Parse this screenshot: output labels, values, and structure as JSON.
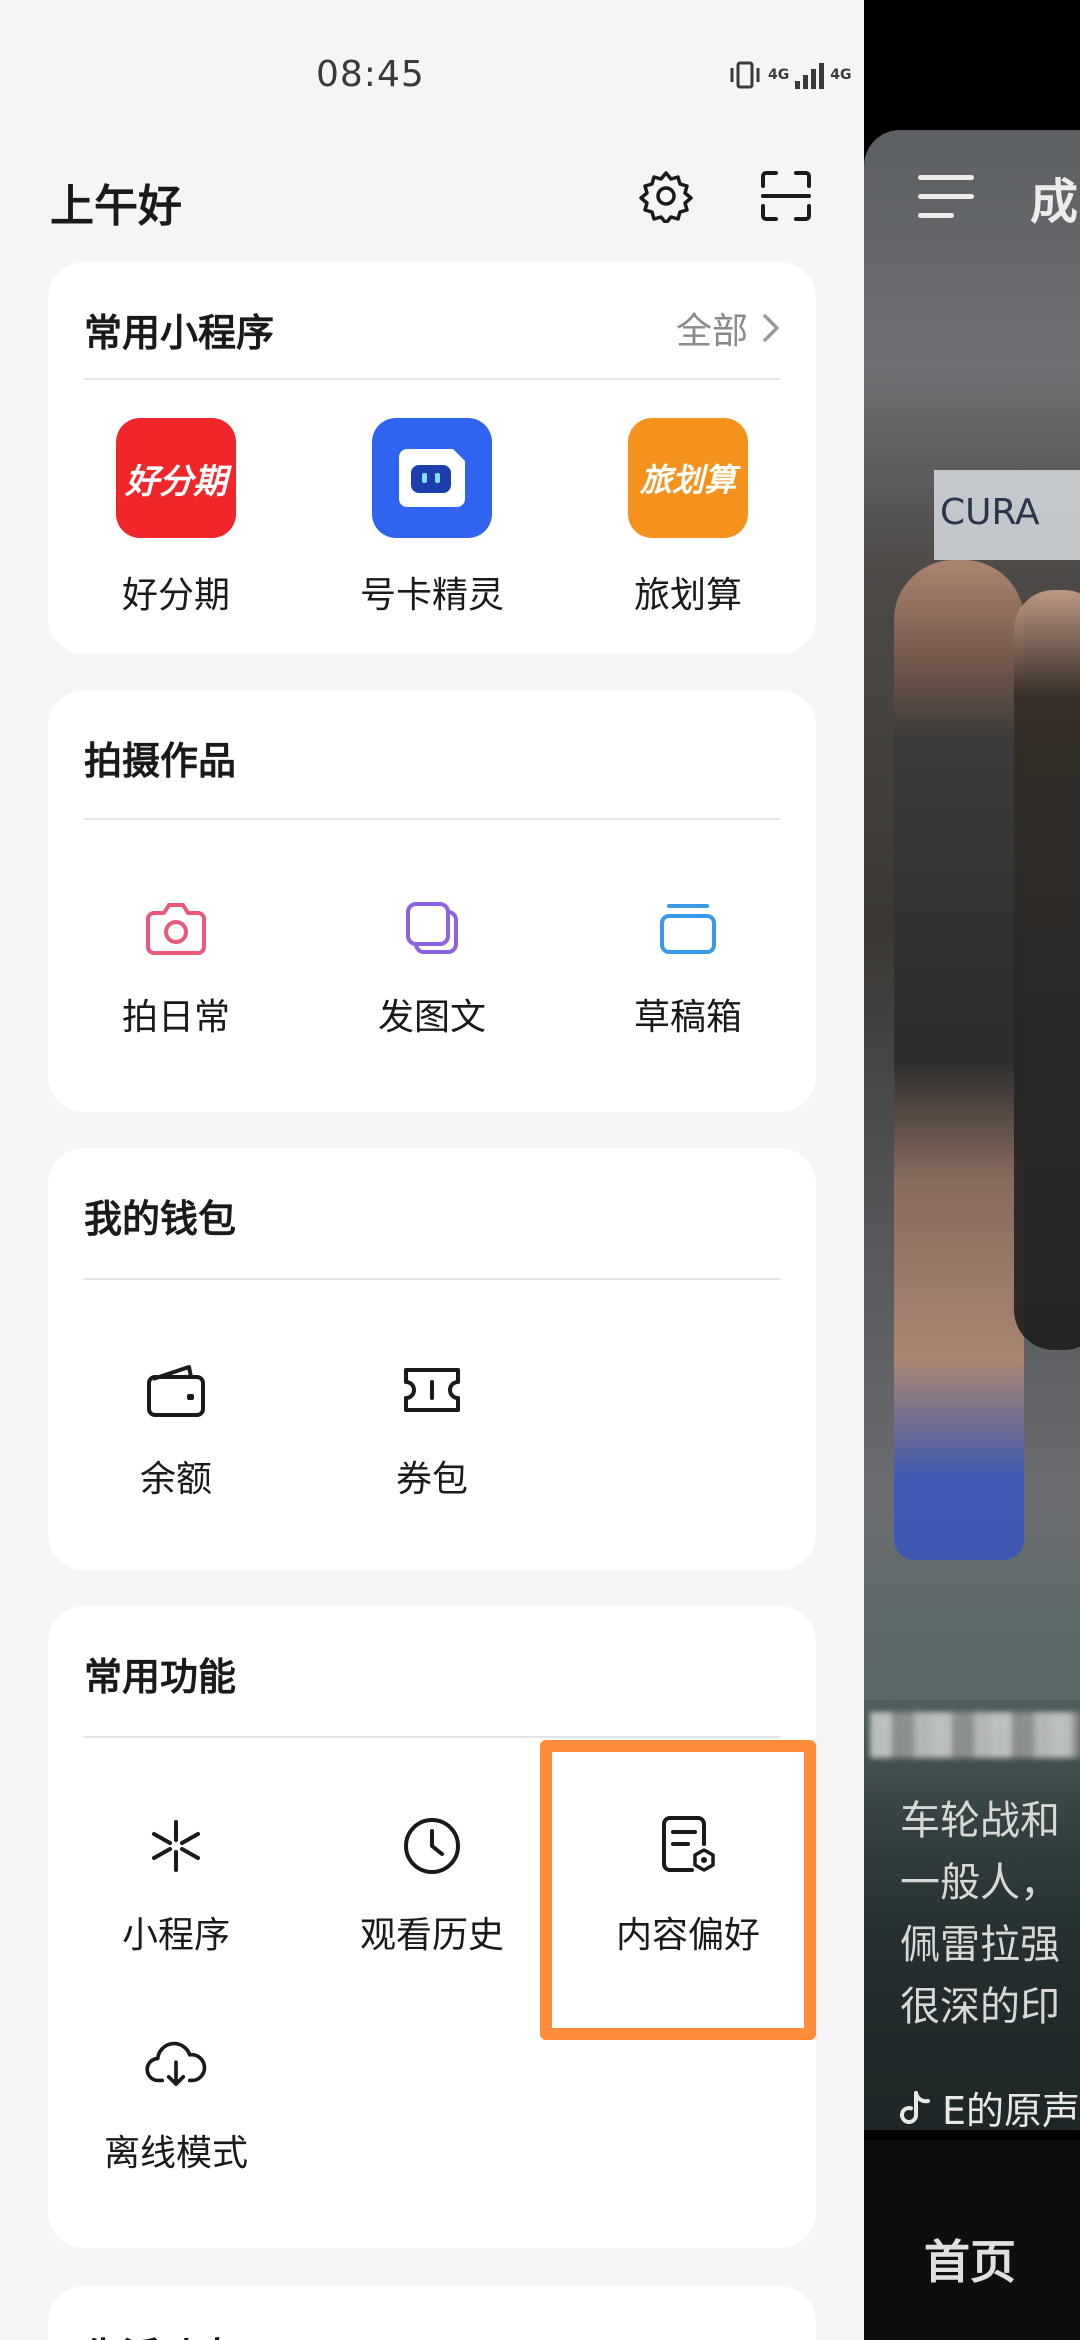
{
  "status_bar": {
    "time": "08:45",
    "network_label_1": "4G",
    "network_label_2": "4G"
  },
  "header": {
    "greeting": "上午好",
    "settings_icon": "gear-icon",
    "scan_icon": "scan-icon"
  },
  "mini_programs": {
    "title": "常用小程序",
    "see_all": "全部",
    "items": [
      {
        "label": "好分期",
        "tile_text": "好分期",
        "color": "#f0262a"
      },
      {
        "label": "号卡精灵",
        "tile_text": "",
        "color": "#2f63f0"
      },
      {
        "label": "旅划算",
        "tile_text": "旅划算",
        "color": "#f5921e"
      }
    ]
  },
  "works": {
    "title": "拍摄作品",
    "items": [
      {
        "label": "拍日常",
        "icon": "camera-icon",
        "color": "#e8597a"
      },
      {
        "label": "发图文",
        "icon": "image-stack-icon",
        "color": "#8f63e0"
      },
      {
        "label": "草稿箱",
        "icon": "drafts-box-icon",
        "color": "#3a9ae8"
      }
    ]
  },
  "wallet": {
    "title": "我的钱包",
    "items": [
      {
        "label": "余额",
        "icon": "wallet-icon"
      },
      {
        "label": "券包",
        "icon": "coupon-icon"
      }
    ]
  },
  "functions": {
    "title": "常用功能",
    "items": [
      {
        "label": "小程序",
        "icon": "mini-program-icon"
      },
      {
        "label": "观看历史",
        "icon": "clock-icon"
      },
      {
        "label": "内容偏好",
        "icon": "content-preference-icon"
      },
      {
        "label": "离线模式",
        "icon": "cloud-download-icon"
      }
    ],
    "highlight_color": "#ff8c3a"
  },
  "next_card": {
    "title": "生活动态"
  },
  "background": {
    "top_char": "成",
    "banner_text": "CURA",
    "caption_lines": [
      "车轮战和",
      "一般人，",
      "佩雷拉强",
      "很深的印"
    ],
    "music_text": "E的原声",
    "nav_home": "首页"
  }
}
